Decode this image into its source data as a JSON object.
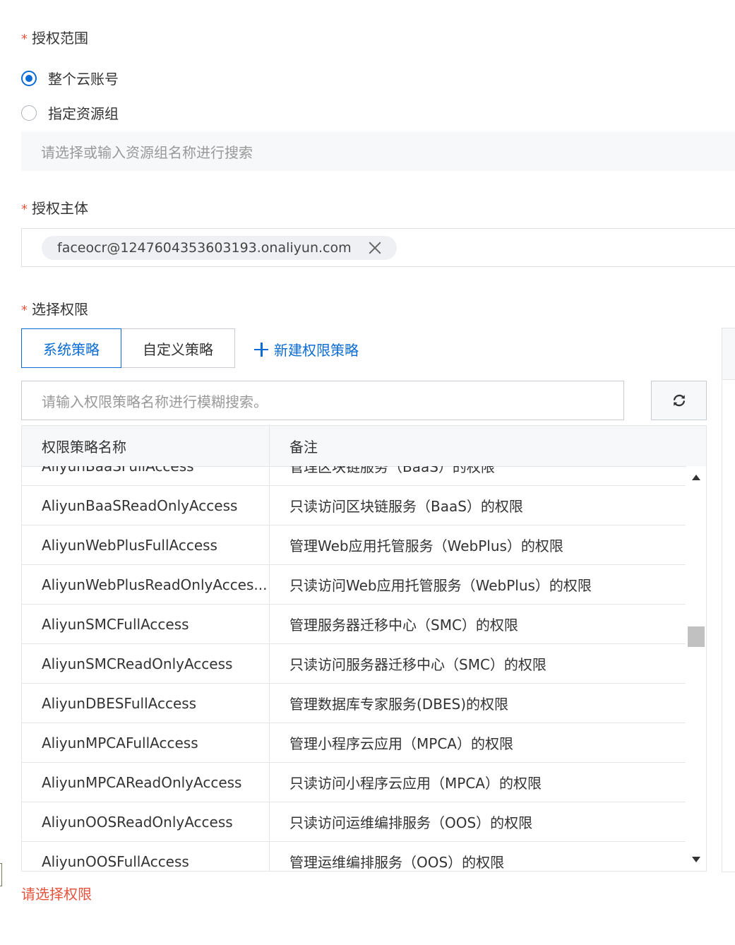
{
  "scope": {
    "required_mark": "*",
    "label": "授权范围",
    "options": [
      {
        "label": "整个云账号",
        "checked": true
      },
      {
        "label": "指定资源组",
        "checked": false
      }
    ],
    "resource_group_placeholder": "请选择或输入资源组名称进行搜索"
  },
  "principal": {
    "required_mark": "*",
    "label": "授权主体",
    "tag": "faceocr@1247604353603193.onaliyun.com"
  },
  "permissions": {
    "required_mark": "*",
    "label": "选择权限",
    "tabs": [
      {
        "label": "系统策略",
        "active": true
      },
      {
        "label": "自定义策略",
        "active": false
      }
    ],
    "new_policy_label": "新建权限策略",
    "search_placeholder": "请输入权限策略名称进行模糊搜索。",
    "table": {
      "headers": [
        "权限策略名称",
        "备注"
      ],
      "rows": [
        {
          "name": "AliyunBaaSFullAccess",
          "note": "管理区块链服务（BaaS）的权限"
        },
        {
          "name": "AliyunBaaSReadOnlyAccess",
          "note": "只读访问区块链服务（BaaS）的权限"
        },
        {
          "name": "AliyunWebPlusFullAccess",
          "note": "管理Web应用托管服务（WebPlus）的权限"
        },
        {
          "name": "AliyunWebPlusReadOnlyAcces...",
          "note": "只读访问Web应用托管服务（WebPlus）的权限"
        },
        {
          "name": "AliyunSMCFullAccess",
          "note": "管理服务器迁移中心（SMC）的权限"
        },
        {
          "name": "AliyunSMCReadOnlyAccess",
          "note": "只读访问服务器迁移中心（SMC）的权限"
        },
        {
          "name": "AliyunDBESFullAccess",
          "note": "管理数据库专家服务(DBES)的权限"
        },
        {
          "name": "AliyunMPCAFullAccess",
          "note": "管理小程序云应用（MPCA）的权限"
        },
        {
          "name": "AliyunMPCAReadOnlyAccess",
          "note": "只读访问小程序云应用（MPCA）的权限"
        },
        {
          "name": "AliyunOOSReadOnlyAccess",
          "note": "只读访问运维编排服务（OOS）的权限"
        },
        {
          "name": "AliyunOOSFullAccess",
          "note": "管理运维编排服务（OOS）的权限"
        }
      ]
    },
    "error": "请选择权限"
  },
  "colors": {
    "primary": "#0a6cd4",
    "required": "#e5533d",
    "border": "#c8ccd2"
  },
  "icons": {
    "refresh": "refresh-icon",
    "close": "close-icon",
    "plus": "plus-icon"
  }
}
